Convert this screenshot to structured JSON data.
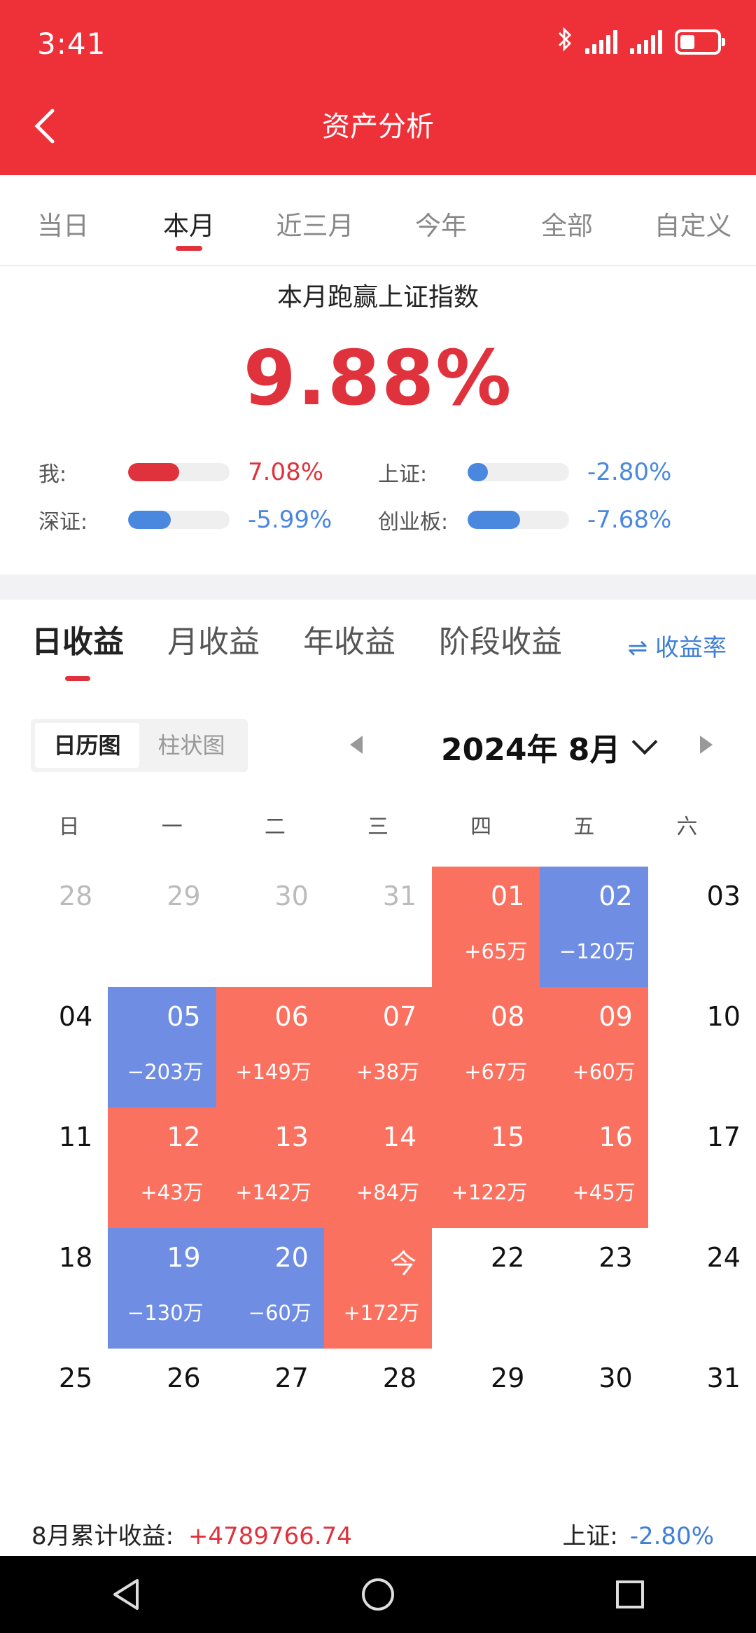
{
  "status": {
    "time": "3:41"
  },
  "header": {
    "title": "资产分析"
  },
  "range_tabs": [
    "当日",
    "本月",
    "近三月",
    "今年",
    "全部",
    "自定义"
  ],
  "range_active": 1,
  "beat": {
    "title": "本月跑赢上证指数",
    "value": "9.88%"
  },
  "compare": [
    {
      "label": "我:",
      "value": "7.08%",
      "level": 0.5,
      "color": "#e0323c"
    },
    {
      "label": "上证:",
      "value": "-2.80%",
      "level": 0.2,
      "color": "#4a88e0"
    },
    {
      "label": "深证:",
      "value": "-5.99%",
      "level": 0.42,
      "color": "#4a88e0"
    },
    {
      "label": "创业板:",
      "value": "-7.68%",
      "level": 0.52,
      "color": "#4a88e0"
    }
  ],
  "return_tabs": [
    "日收益",
    "月收益",
    "年收益",
    "阶段收益"
  ],
  "return_tab_active": 0,
  "rate_toggle": "⇌ 收益率",
  "view_toggle": [
    "日历图",
    "柱状图"
  ],
  "view_active": 0,
  "calendar": {
    "month_label": "2024年 8月",
    "weekdays": [
      "日",
      "一",
      "二",
      "三",
      "四",
      "五",
      "六"
    ],
    "weeks": [
      [
        {
          "day": "28",
          "kind": "other"
        },
        {
          "day": "29",
          "kind": "other"
        },
        {
          "day": "30",
          "kind": "other"
        },
        {
          "day": "31",
          "kind": "other"
        },
        {
          "day": "01",
          "kind": "up",
          "pnl": "+65万"
        },
        {
          "day": "02",
          "kind": "down",
          "pnl": "−120万"
        },
        {
          "day": "03",
          "kind": "plain"
        }
      ],
      [
        {
          "day": "04",
          "kind": "plain"
        },
        {
          "day": "05",
          "kind": "down",
          "pnl": "−203万"
        },
        {
          "day": "06",
          "kind": "up",
          "pnl": "+149万"
        },
        {
          "day": "07",
          "kind": "up",
          "pnl": "+38万"
        },
        {
          "day": "08",
          "kind": "up",
          "pnl": "+67万"
        },
        {
          "day": "09",
          "kind": "up",
          "pnl": "+60万"
        },
        {
          "day": "10",
          "kind": "plain"
        }
      ],
      [
        {
          "day": "11",
          "kind": "plain"
        },
        {
          "day": "12",
          "kind": "up",
          "pnl": "+43万"
        },
        {
          "day": "13",
          "kind": "up",
          "pnl": "+142万"
        },
        {
          "day": "14",
          "kind": "up",
          "pnl": "+84万"
        },
        {
          "day": "15",
          "kind": "up",
          "pnl": "+122万"
        },
        {
          "day": "16",
          "kind": "up",
          "pnl": "+45万"
        },
        {
          "day": "17",
          "kind": "plain"
        }
      ],
      [
        {
          "day": "18",
          "kind": "plain"
        },
        {
          "day": "19",
          "kind": "down",
          "pnl": "−130万"
        },
        {
          "day": "20",
          "kind": "down",
          "pnl": "−60万"
        },
        {
          "day": "今",
          "kind": "up",
          "pnl": "+172万"
        },
        {
          "day": "22",
          "kind": "plain"
        },
        {
          "day": "23",
          "kind": "plain"
        },
        {
          "day": "24",
          "kind": "plain"
        }
      ],
      [
        {
          "day": "25",
          "kind": "plain"
        },
        {
          "day": "26",
          "kind": "plain"
        },
        {
          "day": "27",
          "kind": "plain"
        },
        {
          "day": "28",
          "kind": "plain"
        },
        {
          "day": "29",
          "kind": "plain"
        },
        {
          "day": "30",
          "kind": "plain"
        },
        {
          "day": "31",
          "kind": "plain"
        }
      ]
    ]
  },
  "summary": {
    "cum_label": "8月累计收益:",
    "cum_value": "+4789766.74",
    "idx_label": "上证:",
    "idx_value": "-2.80%"
  },
  "colors": {
    "red": "#e0323c",
    "blue": "#4a88e0"
  }
}
